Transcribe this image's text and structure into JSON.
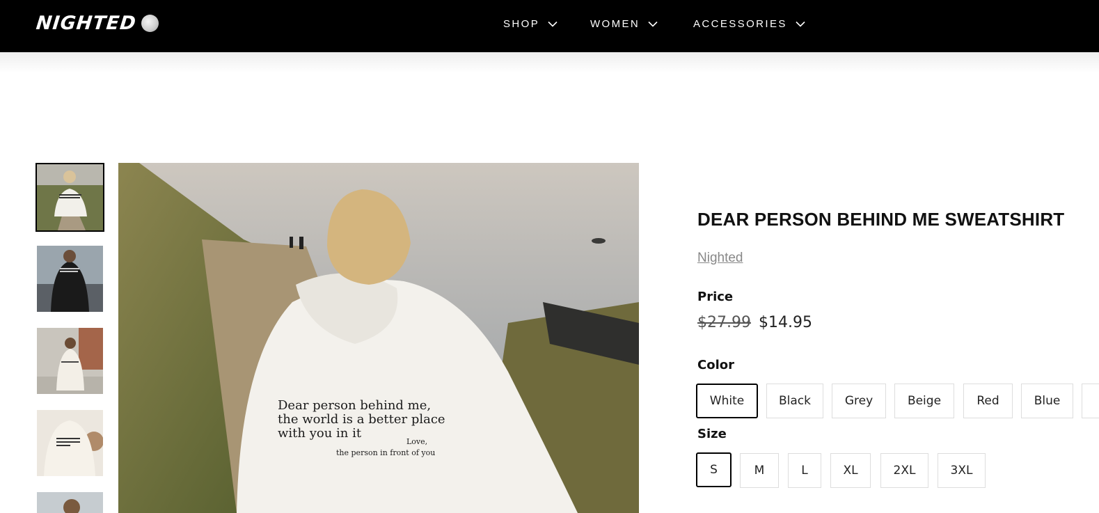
{
  "brand": {
    "logo_text": "NIGHTED",
    "logo_icon": "moon-icon"
  },
  "nav": [
    {
      "label": "SHOP",
      "icon": "chevron-down-icon"
    },
    {
      "label": "WOMEN",
      "icon": "chevron-down-icon"
    },
    {
      "label": "ACCESSORIES",
      "icon": "chevron-down-icon"
    }
  ],
  "gallery": {
    "thumbnail_count_visible": 5,
    "active_index": 0,
    "main_image_print": {
      "line1": "Dear person behind me,",
      "line2": "the world is a better place",
      "line3": "with you in it",
      "signoff1": "Love,",
      "signoff2": "the person in front of you"
    }
  },
  "product": {
    "title": "DEAR PERSON BEHIND ME SWEATSHIRT",
    "vendor": "Nighted",
    "price_label": "Price",
    "price_compare": "$27.99",
    "price_current": "$14.95",
    "color_label": "Color",
    "colors": [
      "White",
      "Black",
      "Grey",
      "Beige",
      "Red",
      "Blue"
    ],
    "selected_color": "White",
    "size_label": "Size",
    "sizes": [
      "S",
      "M",
      "L",
      "XL",
      "2XL",
      "3XL"
    ],
    "selected_size": "S"
  },
  "colors": {
    "header_bg": "#000000",
    "text": "#111111",
    "vendor": "#888888",
    "border": "#dddddd",
    "selected_border": "#000000"
  }
}
